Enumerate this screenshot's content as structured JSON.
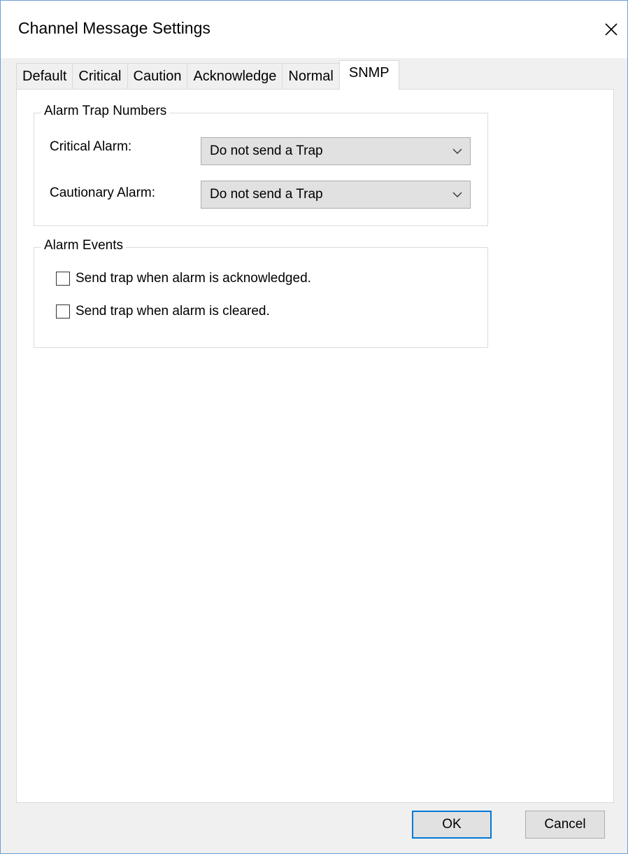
{
  "window": {
    "title": "Channel Message Settings"
  },
  "tabs": [
    {
      "label": "Default",
      "active": false
    },
    {
      "label": "Critical",
      "active": false
    },
    {
      "label": "Caution",
      "active": false
    },
    {
      "label": "Acknowledge",
      "active": false
    },
    {
      "label": "Normal",
      "active": false
    },
    {
      "label": "SNMP",
      "active": true
    }
  ],
  "alarm_trap_numbers": {
    "legend": "Alarm Trap Numbers",
    "critical": {
      "label": "Critical Alarm:",
      "value": "Do not send a Trap"
    },
    "cautionary": {
      "label": "Cautionary Alarm:",
      "value": "Do not send a Trap"
    }
  },
  "alarm_events": {
    "legend": "Alarm Events",
    "ack": {
      "label": "Send trap when alarm is acknowledged.",
      "checked": false
    },
    "cleared": {
      "label": "Send trap when alarm is cleared.",
      "checked": false
    }
  },
  "buttons": {
    "ok": "OK",
    "cancel": "Cancel"
  },
  "icons": {
    "close": "close-icon",
    "dropdown": "chevron-down-icon"
  },
  "colors": {
    "focus_border": "#0078d7",
    "window_border": "#6b9fd3"
  }
}
